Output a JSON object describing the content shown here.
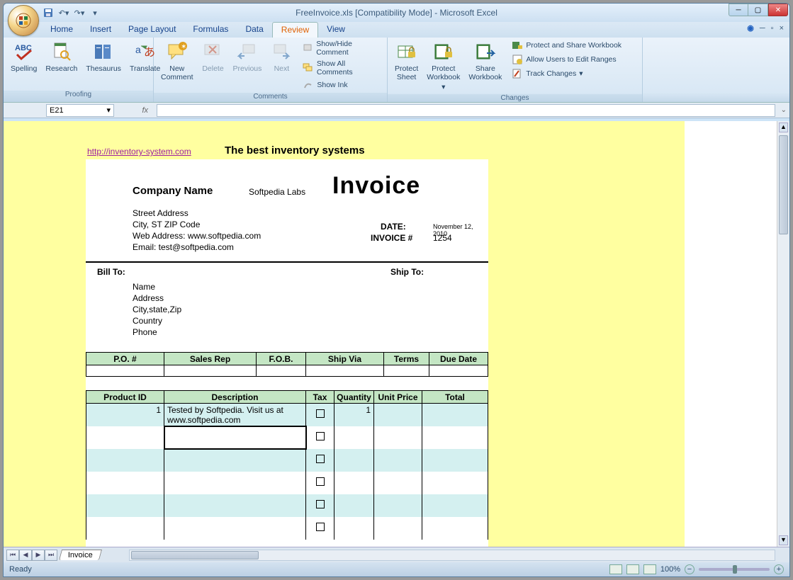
{
  "title": "FreeInvoice.xls  [Compatibility Mode] - Microsoft Excel",
  "tabs": [
    "Home",
    "Insert",
    "Page Layout",
    "Formulas",
    "Data",
    "Review",
    "View"
  ],
  "active_tab": "Review",
  "ribbon": {
    "proofing": {
      "label": "Proofing",
      "spelling": "Spelling",
      "research": "Research",
      "thesaurus": "Thesaurus",
      "translate": "Translate"
    },
    "comments": {
      "label": "Comments",
      "new_comment": "New\nComment",
      "delete": "Delete",
      "previous": "Previous",
      "next": "Next",
      "show_hide": "Show/Hide Comment",
      "show_all": "Show All Comments",
      "show_ink": "Show Ink"
    },
    "changes": {
      "label": "Changes",
      "protect_sheet": "Protect\nSheet",
      "protect_workbook": "Protect\nWorkbook",
      "share_workbook": "Share\nWorkbook",
      "protect_share": "Protect and Share Workbook",
      "allow_users": "Allow Users to Edit Ranges",
      "track_changes": "Track Changes"
    }
  },
  "namebox": "E21",
  "banner": {
    "link": "http://inventory-system.com",
    "text": "The best inventory systems"
  },
  "invoice": {
    "company_label": "Company Name",
    "company_value": "Softpedia Labs",
    "title": "Invoice",
    "address": [
      "Street Address",
      "City, ST  ZIP Code",
      "Web Address: www.softpedia.com",
      "Email: test@softpedia.com"
    ],
    "date_label": "DATE:",
    "date_value": "November 12, 2010",
    "invno_label": "INVOICE #",
    "invno_value": "1254",
    "billto_label": "Bill To:",
    "shipto_label": "Ship To:",
    "billto": [
      "Name",
      "Address",
      "City,state,Zip",
      "Country",
      "Phone"
    ],
    "table1_headers": [
      "P.O. #",
      "Sales Rep",
      "F.O.B.",
      "Ship Via",
      "Terms",
      "Due Date"
    ],
    "table2_headers": [
      "Product ID",
      "Description",
      "Tax",
      "Quantity",
      "Unit Price",
      "Total"
    ],
    "row1": {
      "product_id": "1",
      "description": "Tested by Softpedia. Visit us at www.softpedia.com",
      "quantity": "1"
    }
  },
  "sheet_tab": "Invoice",
  "status": "Ready",
  "zoom": "100%"
}
